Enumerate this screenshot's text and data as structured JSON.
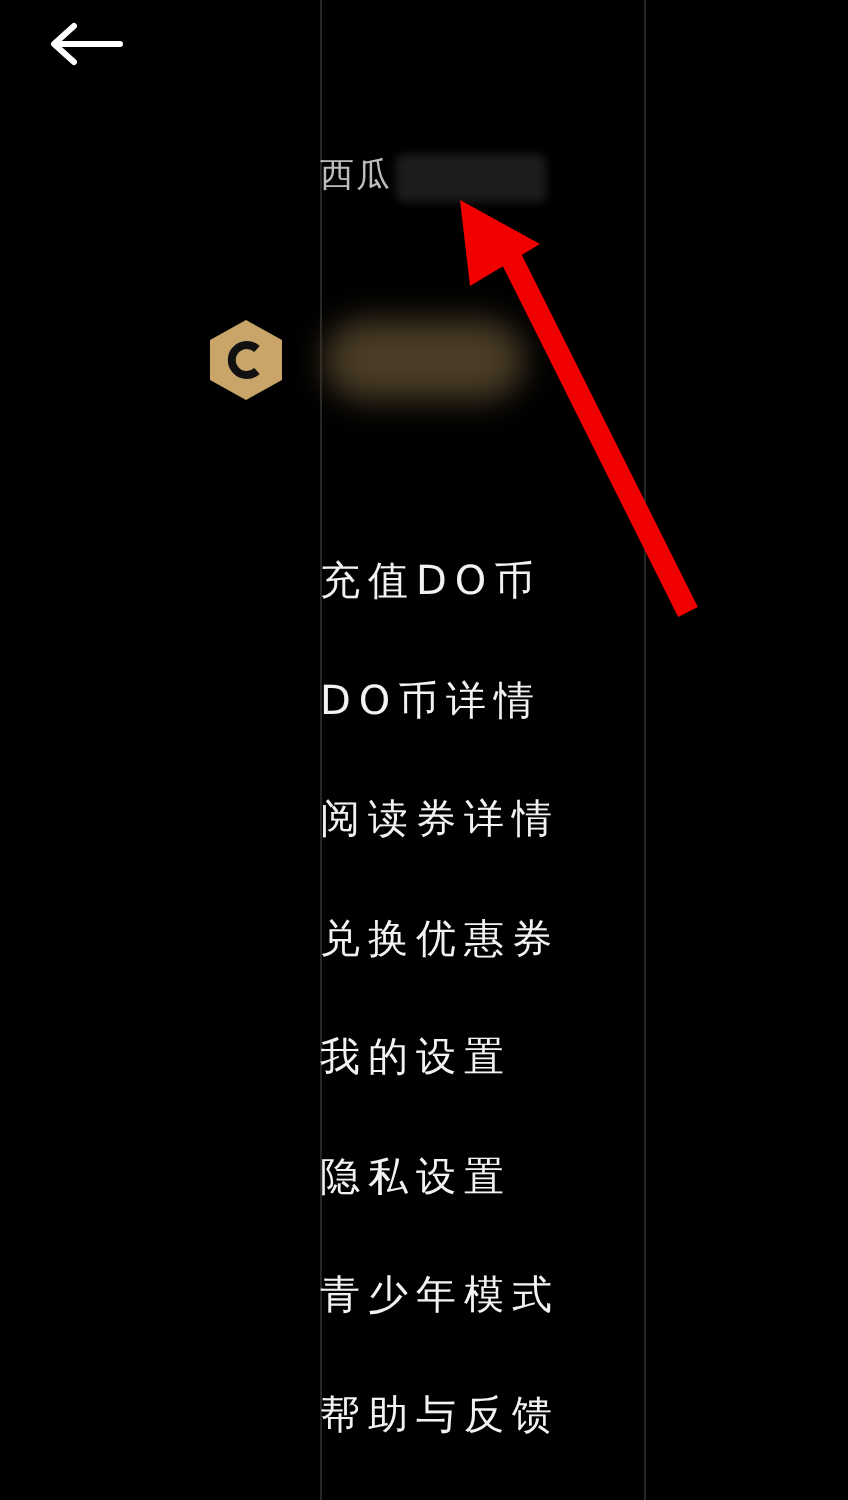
{
  "user": {
    "name": "西瓜"
  },
  "menu": [
    {
      "label": "充值DO币"
    },
    {
      "label": "DO币详情"
    },
    {
      "label": "阅读券详情"
    },
    {
      "label": "兑换优惠券"
    },
    {
      "label": "我的设置"
    },
    {
      "label": "隐私设置"
    },
    {
      "label": "青少年模式"
    },
    {
      "label": "帮助与反馈"
    }
  ]
}
